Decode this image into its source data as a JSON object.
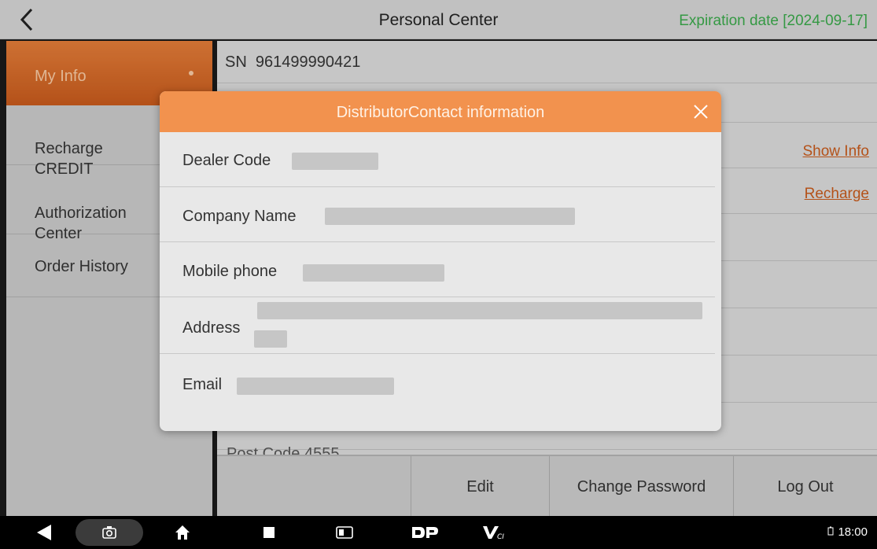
{
  "header": {
    "title": "Personal Center",
    "expiration": "Expiration date [2024-09-17]"
  },
  "sidebar": {
    "items": [
      {
        "label": "My Info"
      },
      {
        "label": "Recharge\nCREDIT"
      },
      {
        "label": "Authorization\nCenter"
      },
      {
        "label": "Order History"
      }
    ]
  },
  "panel": {
    "sn_label": "SN",
    "sn_value": "961499990421",
    "show_info": "Show Info",
    "recharge": "Recharge",
    "post_code": "Post Code 4555"
  },
  "buttons": {
    "edit": "Edit",
    "change_password": "Change Password",
    "log_out": "Log Out"
  },
  "modal": {
    "title": "DistributorContact information",
    "fields": [
      {
        "label": "Dealer Code"
      },
      {
        "label": "Company Name"
      },
      {
        "label": "Mobile phone"
      },
      {
        "label": "Address"
      },
      {
        "label": "Email"
      }
    ]
  },
  "statusbar": {
    "time": "18:00"
  },
  "colors": {
    "accent": "#f2924e",
    "sidebar_active": "#c4591c",
    "expiry_green": "#3aa64a"
  }
}
